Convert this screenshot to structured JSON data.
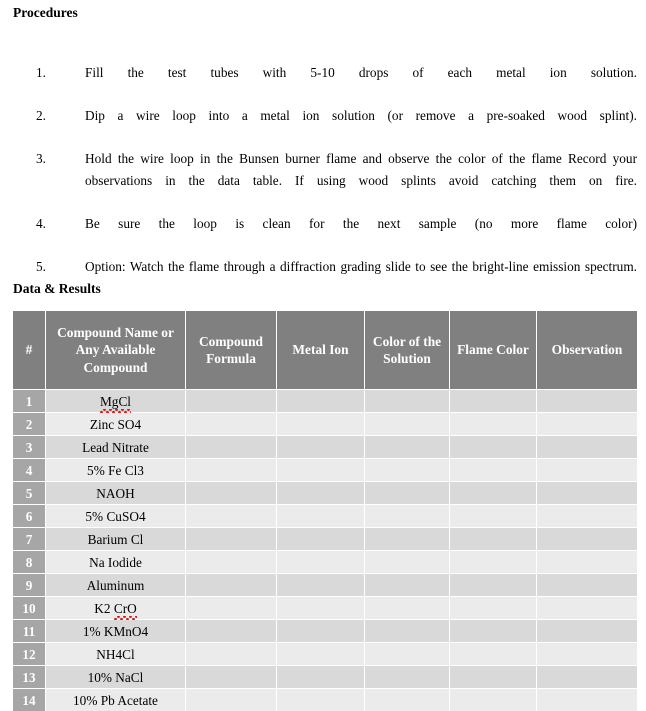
{
  "document": {
    "procedures_heading": "Procedures",
    "data_results_heading": "Data & Results"
  },
  "procedures": {
    "items": [
      {
        "number": "1.",
        "text": "Fill the test tubes with 5-10 drops of each metal ion solution."
      },
      {
        "number": "2.",
        "text": "Dip a wire loop into a metal ion solution (or remove a pre-soaked wood splint)."
      },
      {
        "number": "3.",
        "text": "Hold the wire loop in the Bunsen burner flame and observe the color of the flame Record your observations in the data table.  If using wood splints avoid catching them on fire."
      },
      {
        "number": "4.",
        "text": "Be sure the loop is clean for the next sample (no more flame color)"
      },
      {
        "number": "5.",
        "text": "Option:  Watch the flame through a diffraction grading slide to see the bright-line emission spectrum."
      }
    ]
  },
  "table": {
    "headers": [
      "#",
      "Compound Name or Any Available Compound",
      "Compound Formula",
      "Metal Ion",
      "Color of the Solution",
      "Flame Color",
      "Observation"
    ],
    "rows": [
      {
        "num": "1",
        "compound_name": "MgCl",
        "misspelled": "MgCl",
        "formula": "",
        "metal_ion": "",
        "solution_color": "",
        "flame_color": "",
        "observation": ""
      },
      {
        "num": "2",
        "compound_name": "Zinc SO4",
        "misspelled": "",
        "formula": "",
        "metal_ion": "",
        "solution_color": "",
        "flame_color": "",
        "observation": ""
      },
      {
        "num": "3",
        "compound_name": "Lead Nitrate",
        "misspelled": "",
        "formula": "",
        "metal_ion": "",
        "solution_color": "",
        "flame_color": "",
        "observation": ""
      },
      {
        "num": "4",
        "compound_name": "5% Fe Cl3",
        "misspelled": "",
        "formula": "",
        "metal_ion": "",
        "solution_color": "",
        "flame_color": "",
        "observation": ""
      },
      {
        "num": "5",
        "compound_name": "NAOH",
        "misspelled": "",
        "formula": "",
        "metal_ion": "",
        "solution_color": "",
        "flame_color": "",
        "observation": ""
      },
      {
        "num": "6",
        "compound_name": "5% CuSO4",
        "misspelled": "",
        "formula": "",
        "metal_ion": "",
        "solution_color": "",
        "flame_color": "",
        "observation": ""
      },
      {
        "num": "7",
        "compound_name": "Barium Cl",
        "misspelled": "",
        "formula": "",
        "metal_ion": "",
        "solution_color": "",
        "flame_color": "",
        "observation": ""
      },
      {
        "num": "8",
        "compound_name": "Na Iodide",
        "misspelled": "",
        "formula": "",
        "metal_ion": "",
        "solution_color": "",
        "flame_color": "",
        "observation": ""
      },
      {
        "num": "9",
        "compound_name": "Aluminum",
        "misspelled": "",
        "formula": "",
        "metal_ion": "",
        "solution_color": "",
        "flame_color": "",
        "observation": ""
      },
      {
        "num": "10",
        "compound_name": "K2 CrO",
        "misspelled": "CrO",
        "formula": "",
        "metal_ion": "",
        "solution_color": "",
        "flame_color": "",
        "observation": ""
      },
      {
        "num": "11",
        "compound_name": "1% KMnO4",
        "misspelled": "",
        "formula": "",
        "metal_ion": "",
        "solution_color": "",
        "flame_color": "",
        "observation": ""
      },
      {
        "num": "12",
        "compound_name": "NH4Cl",
        "misspelled": "",
        "formula": "",
        "metal_ion": "",
        "solution_color": "",
        "flame_color": "",
        "observation": ""
      },
      {
        "num": "13",
        "compound_name": "10% NaCl",
        "misspelled": "",
        "formula": "",
        "metal_ion": "",
        "solution_color": "",
        "flame_color": "",
        "observation": ""
      },
      {
        "num": "14",
        "compound_name": "10% Pb Acetate",
        "misspelled": "",
        "formula": "",
        "metal_ion": "",
        "solution_color": "",
        "flame_color": "",
        "observation": ""
      }
    ]
  },
  "colors": {
    "header_background": "#808080",
    "header_text": "#ffffff",
    "number_column_background": "#a6a6a6",
    "row_odd_background": "#d9d9d9",
    "row_even_background": "#ebebeb",
    "gridline": "#ffffff",
    "spellcheck_underline": "#e01b1b",
    "page_background": "#ffffff",
    "body_text": "#000000"
  }
}
